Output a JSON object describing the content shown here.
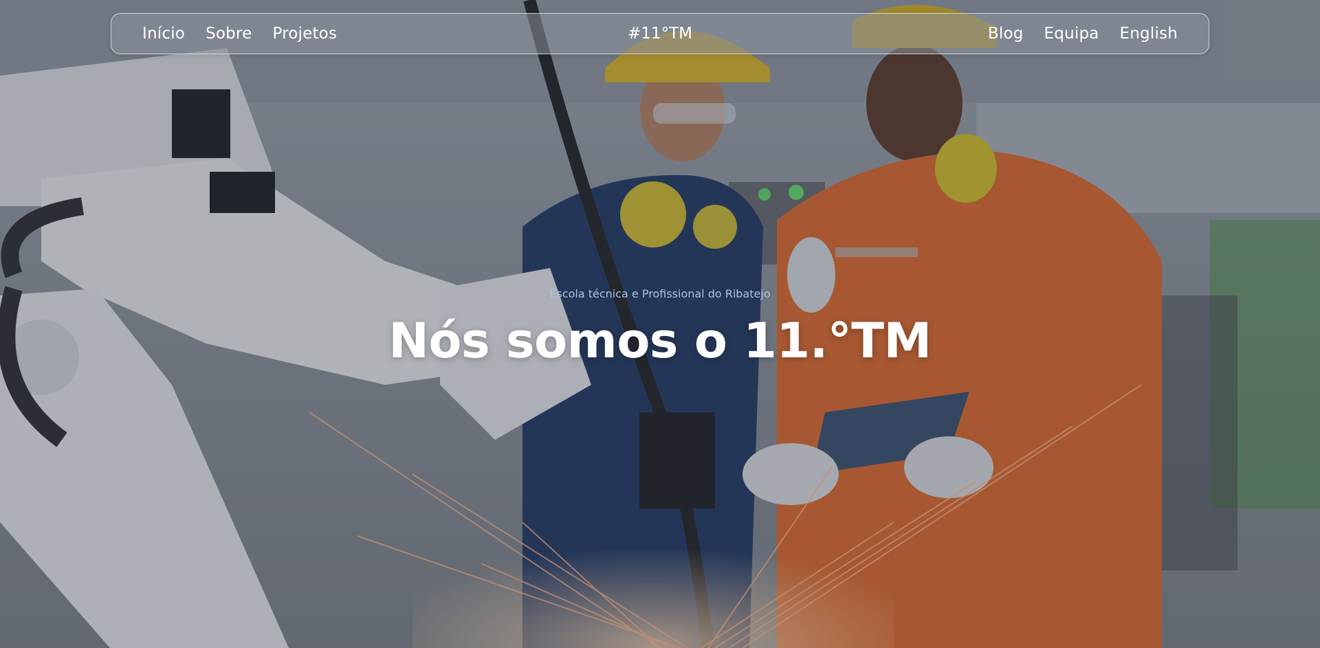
{
  "nav": {
    "left_links": [
      {
        "label": "Início"
      },
      {
        "label": "Sobre"
      },
      {
        "label": "Projetos"
      }
    ],
    "brand": "#11°TM",
    "right_links": [
      {
        "label": "Blog"
      },
      {
        "label": "Equipa"
      },
      {
        "label": "English"
      }
    ]
  },
  "hero": {
    "eyebrow": "Escola técnica e Profissional do Ribatejo",
    "headline": "Nós somos o 11.°TM",
    "background": "industrial-robot-welding-and-two-workers-photo"
  },
  "colors": {
    "eyebrow": "#a9c3e4",
    "headline": "#ffffff",
    "orange_suit": "#d9682e",
    "blue_suit": "#223c66",
    "helmet": "#d8b62a"
  }
}
